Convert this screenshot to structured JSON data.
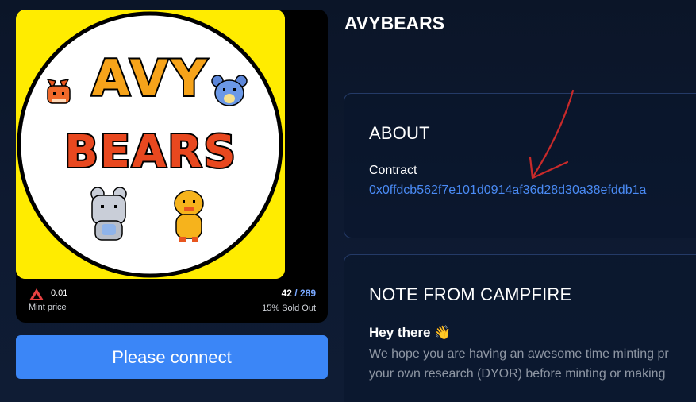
{
  "collection": {
    "title": "AVYBEARS",
    "artwork_text": [
      "AVY",
      "BEARS"
    ]
  },
  "mint": {
    "price_value": "0.01",
    "price_label": "Mint price",
    "minted_count": "42",
    "separator": " / ",
    "total_supply": "289",
    "sold_out_text": "15% Sold Out",
    "progress_fraction": 0.15
  },
  "connect_button": {
    "label": "Please connect"
  },
  "about": {
    "title": "ABOUT",
    "contract_label": "Contract",
    "contract_address": "0x0ffdcb562f7e101d0914af36d28d30a38efddb1a"
  },
  "note": {
    "title": "NOTE FROM CAMPFIRE",
    "heading": "Hey there 👋",
    "body_line_1": "We hope you are having an awesome time minting pr",
    "body_line_2": "your own research (DYOR) before minting or making"
  },
  "icons": {
    "avax": "avalanche-logo-icon",
    "annotation": "red-arrow-annotation"
  },
  "colors": {
    "accent": "#3b86f7",
    "link": "#4a8bf5",
    "avax_red": "#e84142",
    "artwork_background": "#ffec00",
    "annotation": "#c92a2a"
  }
}
